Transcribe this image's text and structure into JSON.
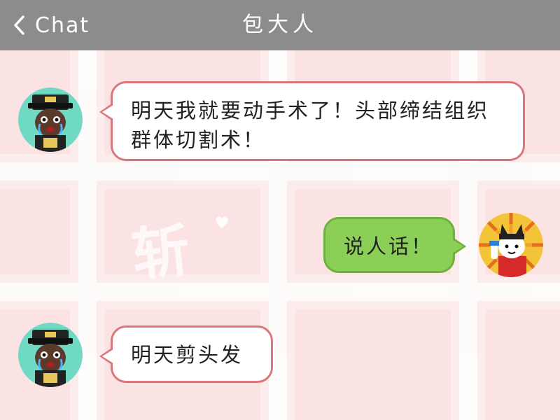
{
  "header": {
    "back_label": "Chat",
    "title": "包大人",
    "back_icon": "chevron-left-icon",
    "background_color": "#8c8c8c"
  },
  "wallpaper": {
    "watermark": "斩",
    "heart_icon": "heart-icon",
    "background_color": "#fbe3e3",
    "grid_color": "#ffffff"
  },
  "messages": [
    {
      "sender": "left",
      "avatar_icon": "judge-bao-avatar",
      "text_line1": "明天我就要动手术了！头部缔结组织",
      "text_line2": "群体切割术！",
      "bubble_color": "#ffffff",
      "border_color": "#d9787a"
    },
    {
      "sender": "right",
      "avatar_icon": "cat-avatar",
      "text": "说人话！",
      "bubble_color": "#8ccf56",
      "border_color": "#6fb13f"
    },
    {
      "sender": "left",
      "avatar_icon": "judge-bao-avatar",
      "text": "明天剪头发",
      "bubble_color": "#ffffff",
      "border_color": "#d9787a"
    }
  ]
}
